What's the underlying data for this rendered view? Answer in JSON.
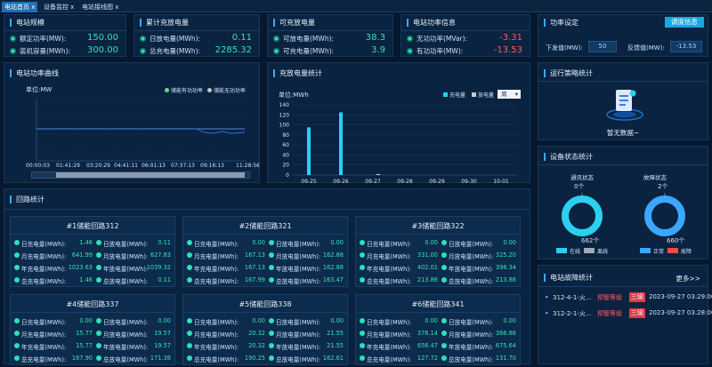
{
  "tabs": [
    {
      "label": "电站首页 x",
      "active": true
    },
    {
      "label": "设备监控 x",
      "active": false
    },
    {
      "label": "电站接线图 x",
      "active": false
    }
  ],
  "station_scale": {
    "title": "电站规模",
    "rows": [
      {
        "label": "额定功率(MW):",
        "value": "150.00"
      },
      {
        "label": "装机容量(MWh):",
        "value": "300.00"
      }
    ]
  },
  "cumulative": {
    "title": "累计充放电量",
    "rows": [
      {
        "label": "日放电量(MWh):",
        "value": "0.11"
      },
      {
        "label": "总充电量(MWh):",
        "value": "2285.32"
      }
    ]
  },
  "chargeable": {
    "title": "可充放电量",
    "rows": [
      {
        "label": "可放电量(MWh):",
        "value": "38.3"
      },
      {
        "label": "可充电量(MWh):",
        "value": "3.9"
      }
    ]
  },
  "power_info": {
    "title": "电站功率信息",
    "rows": [
      {
        "label": "无功功率(MVar):",
        "value": "-3.31"
      },
      {
        "label": "有功功率(MW):",
        "value": "-13.53"
      }
    ]
  },
  "power_setting": {
    "title": "功率设定",
    "button": "调度信息",
    "issue_label": "下发值(MW):",
    "issue_value": "50",
    "feedback_label": "反馈值(MW):",
    "feedback_value": "-13.53"
  },
  "power_curve": {
    "title": "电站功率曲线",
    "unit": "单位:MW",
    "legend": [
      "储能有功功率",
      "储能无功功率"
    ],
    "x_ticks": [
      "00:00:03",
      "01:41:29",
      "03:20:29",
      "04:41:11",
      "06:01:13",
      "07:37:13",
      "09:16:13",
      "11:28:5€"
    ]
  },
  "charge_stats": {
    "title": "充放电量统计",
    "unit": "单位:MWh",
    "legend": [
      "充电量",
      "放电量"
    ],
    "dropdown": "周"
  },
  "chart_data": {
    "type": "bar",
    "categories": [
      "09-25",
      "09-26",
      "09-27",
      "09-28",
      "09-29",
      "09-30",
      "10-01"
    ],
    "series": [
      {
        "name": "充电量",
        "values": [
          95,
          125,
          0,
          0,
          0,
          0,
          0
        ]
      },
      {
        "name": "放电量",
        "values": [
          0,
          0,
          2,
          0,
          0,
          0,
          0
        ]
      }
    ],
    "ylim": [
      0,
      140
    ],
    "y_ticks": [
      "0",
      "20",
      "40",
      "60",
      "80",
      "100",
      "120",
      "140"
    ],
    "xlabel": "",
    "ylabel": ""
  },
  "strategy": {
    "title": "运行策略统计",
    "empty": "暂无数据~"
  },
  "device_status": {
    "title": "设备状态统计",
    "comm_title": "通讯状态",
    "comm_top": "0个",
    "comm_bottom": "662个",
    "comm_legend": [
      "在线",
      "离线"
    ],
    "fault_title": "故障状态",
    "fault_top": "2个",
    "fault_bottom": "660个",
    "fault_legend": [
      "正常",
      "故障"
    ],
    "colors": {
      "online": "#2ad0f0",
      "offline": "#a0a8b2",
      "normal": "#3aa8ff",
      "fault": "#ff4848"
    }
  },
  "fault_stats": {
    "title": "电站故障统计",
    "more": "更多>>",
    "rows": [
      {
        "name": "312-4-1-火...",
        "type": "预警等级",
        "level": "三级",
        "time": "2023-09-27 03:29:00"
      },
      {
        "name": "312-2-1-火...",
        "type": "预警等级",
        "level": "三级",
        "time": "2023-09-27 03:28:00"
      }
    ]
  },
  "loops": {
    "title": "回路统计",
    "items": [
      {
        "name": "#1储能回路312",
        "cells": [
          [
            "日充电量(MWh):",
            "1.46"
          ],
          [
            "日放电量(MWh):",
            "0.11"
          ],
          [
            "月充电量(MWh):",
            "641.99"
          ],
          [
            "月放电量(MWh):",
            "627.83"
          ],
          [
            "年充电量(MWh):",
            "1023.63"
          ],
          [
            "年放电量(MWh):",
            "1039.32"
          ],
          [
            "总充电量(MWh):",
            "1.46"
          ],
          [
            "总放电量(MWh):",
            "0.11"
          ]
        ]
      },
      {
        "name": "#2储能回路321",
        "cells": [
          [
            "日充电量(MWh):",
            "0.00"
          ],
          [
            "日放电量(MWh):",
            "0.00"
          ],
          [
            "月充电量(MWh):",
            "167.13"
          ],
          [
            "月放电量(MWh):",
            "162.88"
          ],
          [
            "年充电量(MWh):",
            "167.13"
          ],
          [
            "年放电量(MWh):",
            "162.88"
          ],
          [
            "总充电量(MWh):",
            "167.99"
          ],
          [
            "总放电量(MWh):",
            "163.47"
          ]
        ]
      },
      {
        "name": "#3储能回路322",
        "cells": [
          [
            "日充电量(MWh):",
            "0.00"
          ],
          [
            "日放电量(MWh):",
            "0.00"
          ],
          [
            "月充电量(MWh):",
            "331.00"
          ],
          [
            "月放电量(MWh):",
            "325.20"
          ],
          [
            "年充电量(MWh):",
            "402.01"
          ],
          [
            "年放电量(MWh):",
            "398.34"
          ],
          [
            "总充电量(MWh):",
            "213.86"
          ],
          [
            "总放电量(MWh):",
            "213.86"
          ]
        ]
      },
      {
        "name": "#4储能回路337",
        "cells": [
          [
            "日充电量(MWh):",
            "0.00"
          ],
          [
            "日放电量(MWh):",
            "0.00"
          ],
          [
            "月充电量(MWh):",
            "15.77"
          ],
          [
            "月放电量(MWh):",
            "19.57"
          ],
          [
            "年充电量(MWh):",
            "15.77"
          ],
          [
            "年放电量(MWh):",
            "19.57"
          ],
          [
            "总充电量(MWh):",
            "167.90"
          ],
          [
            "总放电量(MWh):",
            "171.38"
          ]
        ]
      },
      {
        "name": "#5储能回路338",
        "cells": [
          [
            "日充电量(MWh):",
            "0.00"
          ],
          [
            "日放电量(MWh):",
            "0.00"
          ],
          [
            "月充电量(MWh):",
            "20.32"
          ],
          [
            "月放电量(MWh):",
            "21.55"
          ],
          [
            "年充电量(MWh):",
            "20.32"
          ],
          [
            "年放电量(MWh):",
            "21.55"
          ],
          [
            "总充电量(MWh):",
            "190.25"
          ],
          [
            "总放电量(MWh):",
            "162.61"
          ]
        ]
      },
      {
        "name": "#6储能回路341",
        "cells": [
          [
            "日充电量(MWh):",
            "0.00"
          ],
          [
            "日放电量(MWh):",
            "0.00"
          ],
          [
            "月充电量(MWh):",
            "376.14"
          ],
          [
            "月放电量(MWh):",
            "366.86"
          ],
          [
            "年充电量(MWh):",
            "656.47"
          ],
          [
            "年放电量(MWh):",
            "675.64"
          ],
          [
            "总充电量(MWh):",
            "127.72"
          ],
          [
            "总放电量(MWh):",
            "131.70"
          ]
        ]
      }
    ]
  }
}
